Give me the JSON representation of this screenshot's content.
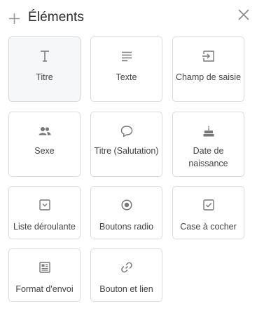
{
  "panel": {
    "title": "Éléments"
  },
  "tiles": [
    {
      "label": "Titre",
      "icon": "text-title-icon",
      "selected": true
    },
    {
      "label": "Texte",
      "icon": "paragraph-lines-icon"
    },
    {
      "label": "Champ de saisie",
      "icon": "input-field-icon"
    },
    {
      "label": "Sexe",
      "icon": "people-icon"
    },
    {
      "label": "Titre (Salutation)",
      "icon": "speech-bubble-icon"
    },
    {
      "label": "Date de naissance",
      "icon": "birthday-cake-icon"
    },
    {
      "label": "Liste déroulante",
      "icon": "dropdown-box-icon"
    },
    {
      "label": "Boutons radio",
      "icon": "radio-button-icon"
    },
    {
      "label": "Case à cocher",
      "icon": "checkbox-checked-icon"
    },
    {
      "label": "Format d'envoi",
      "icon": "newsletter-format-icon"
    },
    {
      "label": "Bouton et lien",
      "icon": "link-icon"
    }
  ]
}
